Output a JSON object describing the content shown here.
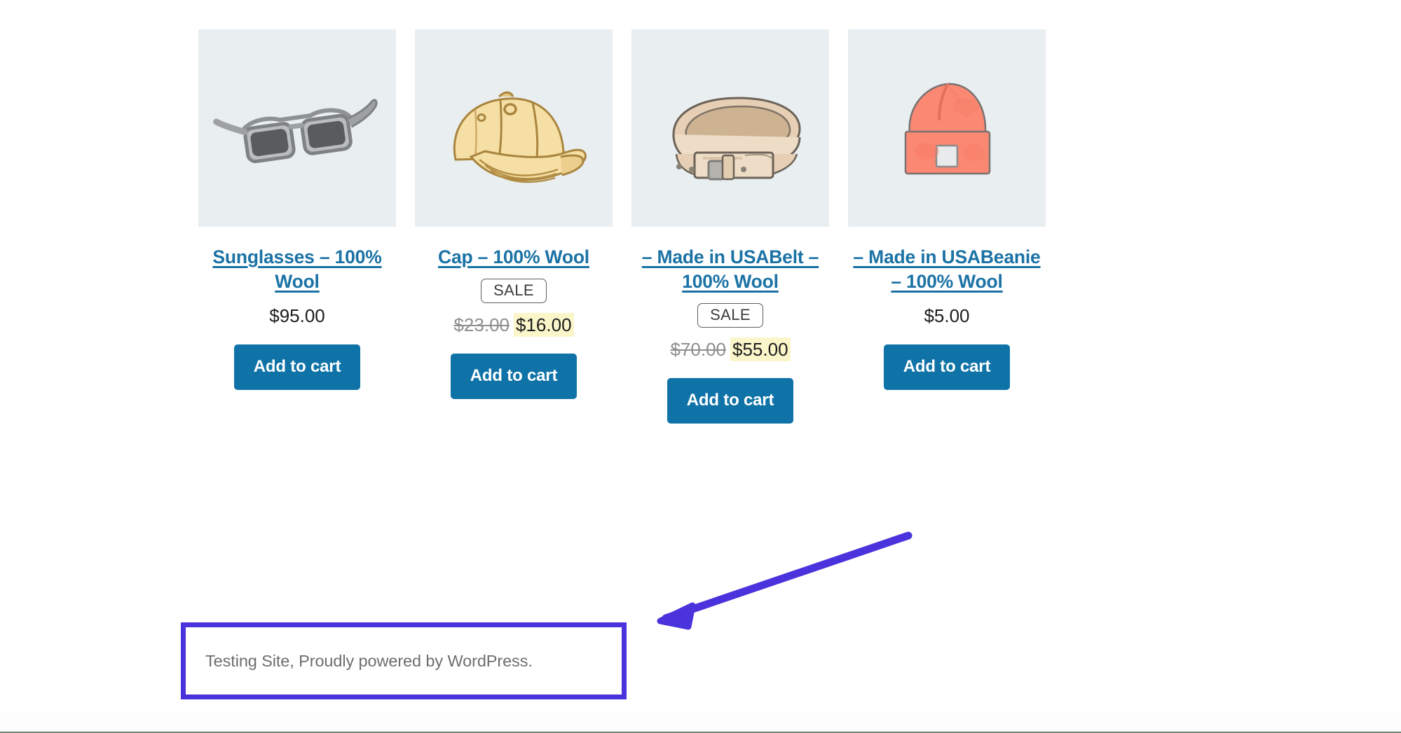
{
  "products": [
    {
      "image": "sunglasses-illustration",
      "title": "Sunglasses – 100% Wool",
      "sale_badge": null,
      "regular_price": null,
      "price": "$95.00",
      "add_to_cart_label": "Add to cart"
    },
    {
      "image": "cap-illustration",
      "title": "Cap – 100% Wool",
      "sale_badge": "SALE",
      "regular_price": "$23.00",
      "price": "$16.00",
      "add_to_cart_label": "Add to cart"
    },
    {
      "image": "belt-illustration",
      "title": "– Made in USABelt – 100% Wool",
      "sale_badge": "SALE",
      "regular_price": "$70.00",
      "price": "$55.00",
      "add_to_cart_label": "Add to cart"
    },
    {
      "image": "beanie-illustration",
      "title": "– Made in USABeanie – 100% Wool",
      "sale_badge": null,
      "regular_price": null,
      "price": "$5.00",
      "add_to_cart_label": "Add to cart"
    }
  ],
  "footer": {
    "text": "Testing Site, Proudly powered by WordPress."
  },
  "annotation": {
    "arrow_color": "#4a32dc",
    "highlight_border_color": "#4a32dc"
  },
  "colors": {
    "link_blue": "#1b72a5",
    "button_blue": "#1073a8",
    "sale_highlight_yellow": "#fbf6c9",
    "old_price_gray": "#8f8f8f",
    "thumb_background": "#e9eef1"
  }
}
